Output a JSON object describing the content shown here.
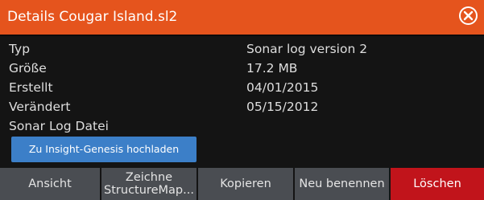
{
  "dialog": {
    "title": "Details Cougar Island.sl2",
    "close_icon": "close-circle-icon"
  },
  "details": [
    {
      "label": "Typ",
      "value": "Sonar log version 2"
    },
    {
      "label": "Größe",
      "value": "17.2 MB"
    },
    {
      "label": "Erstellt",
      "value": "04/01/2015"
    },
    {
      "label": "Verändert",
      "value": "05/15/2012"
    }
  ],
  "sonar_log_label": "Sonar Log Datei",
  "upload_button": "Zu Insight-Genesis hochladen",
  "toolbar": {
    "view": "Ansicht",
    "draw_structuremap_line1": "Zeichne",
    "draw_structuremap_line2": "StructureMap...",
    "copy": "Kopieren",
    "rename": "Neu benennen",
    "delete": "Löschen"
  },
  "colors": {
    "title_bar": "#e5541d",
    "background": "#141414",
    "upload_button": "#3c7fc8",
    "toolbar_button": "#4a4d52",
    "delete_button": "#c1141b"
  }
}
